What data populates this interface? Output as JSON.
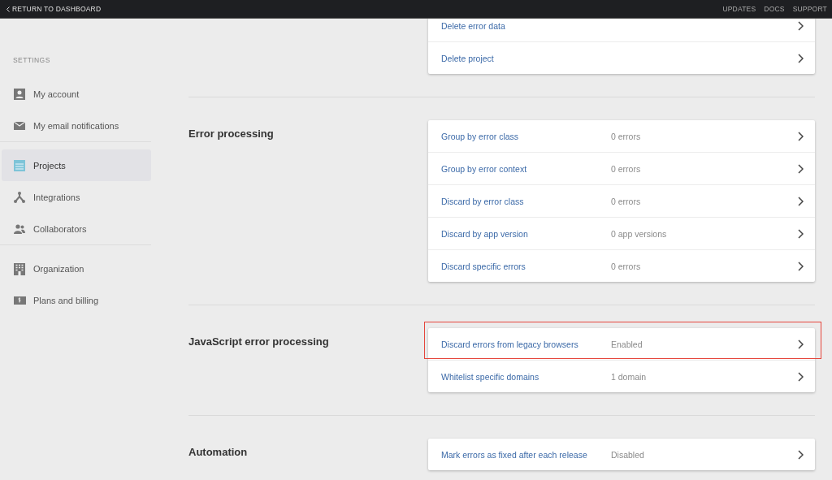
{
  "top_bar": {
    "back_link": "RETURN TO DASHBOARD",
    "links": [
      "UPDATES",
      "DOCS",
      "SUPPORT"
    ]
  },
  "sidebar": {
    "heading": "SETTINGS",
    "groups": [
      {
        "items": [
          {
            "label": "My account",
            "selected": false
          },
          {
            "label": "My email notifications",
            "selected": false
          }
        ]
      },
      {
        "items": [
          {
            "label": "Projects",
            "selected": true
          },
          {
            "label": "Integrations",
            "selected": false
          },
          {
            "label": "Collaborators",
            "selected": false
          }
        ]
      },
      {
        "items": [
          {
            "label": "Organization",
            "selected": false
          },
          {
            "label": "Plans and billing",
            "selected": false
          }
        ]
      }
    ]
  },
  "sections": [
    {
      "rows": [
        {
          "label": "Delete error data",
          "highlighted": false
        },
        {
          "label": "Delete project",
          "highlighted": false
        }
      ]
    },
    {
      "heading": "Error processing",
      "rows": [
        {
          "label": "Group by error class",
          "value": "0 errors",
          "highlighted": false
        },
        {
          "label": "Group by error context",
          "value": "0 errors",
          "highlighted": false
        },
        {
          "label": "Discard by error class",
          "value": "0 errors",
          "highlighted": false
        },
        {
          "label": "Discard by app version",
          "value": "0 app versions",
          "highlighted": false
        },
        {
          "label": "Discard specific errors",
          "value": "0 errors",
          "highlighted": false
        }
      ]
    },
    {
      "heading": "JavaScript error processing",
      "rows": [
        {
          "label": "Discard errors from legacy browsers",
          "value": "Enabled",
          "highlighted": true
        },
        {
          "label": "Whitelist specific domains",
          "value": "1 domain",
          "highlighted": false
        }
      ]
    },
    {
      "heading": "Automation",
      "rows": [
        {
          "label": "Mark errors as fixed after each release",
          "value": "Disabled",
          "highlighted": false
        }
      ]
    }
  ]
}
